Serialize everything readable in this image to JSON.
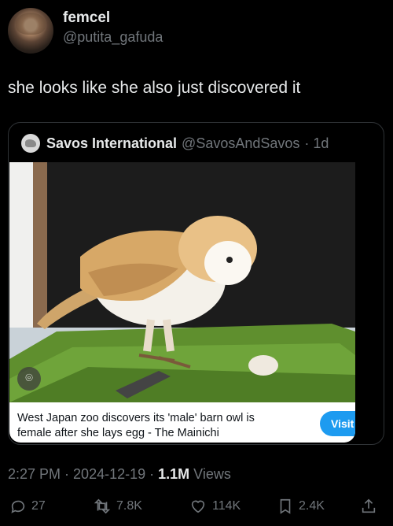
{
  "author": {
    "display_name": "femcel",
    "handle": "@putita_gafuda"
  },
  "tweet": {
    "text": "she looks like she also just discovered it"
  },
  "quoted_tweet": {
    "name": "Savos International",
    "handle": "@SavosAndSavos",
    "time": "· 1d",
    "link_card": {
      "headline_line1": "West Japan zoo discovers its 'male' barn owl is",
      "headline_line2": "female after she lays egg - The Mainichi",
      "visit_label": "Visit ›"
    }
  },
  "meta": {
    "time": "2:27 PM",
    "sep1": " · ",
    "date": "2024-12-19",
    "sep2": " · ",
    "views_count": "1.1M",
    "views_label": " Views"
  },
  "actions": {
    "replies": "27",
    "reposts": "7.8K",
    "likes": "114K",
    "bookmarks": "2.4K"
  },
  "colors": {
    "background": "#000000",
    "accent": "#1d9bf0",
    "muted": "#71767b",
    "text": "#e7e9ea"
  }
}
